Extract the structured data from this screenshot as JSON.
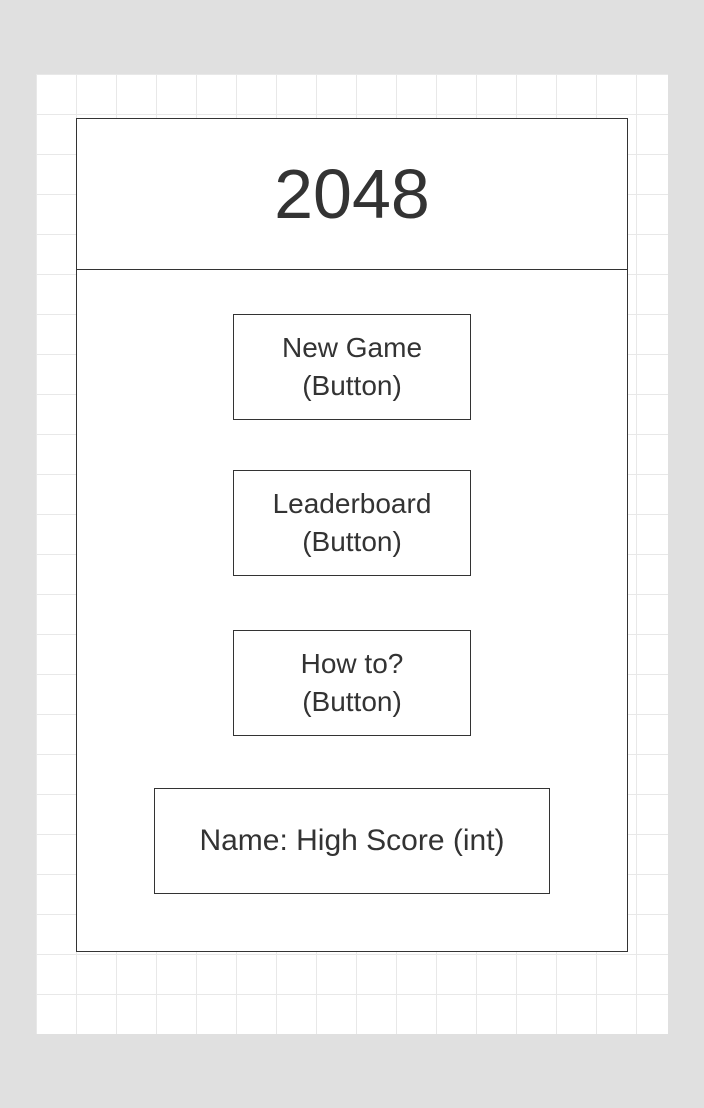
{
  "title": "2048",
  "buttons": {
    "newGame": {
      "line1": "New Game",
      "line2": "(Button)"
    },
    "leaderboard": {
      "line1": "Leaderboard",
      "line2": "(Button)"
    },
    "howTo": {
      "line1": "How to?",
      "line2": "(Button)"
    }
  },
  "highScore": {
    "label": "Name: High Score (int)"
  }
}
